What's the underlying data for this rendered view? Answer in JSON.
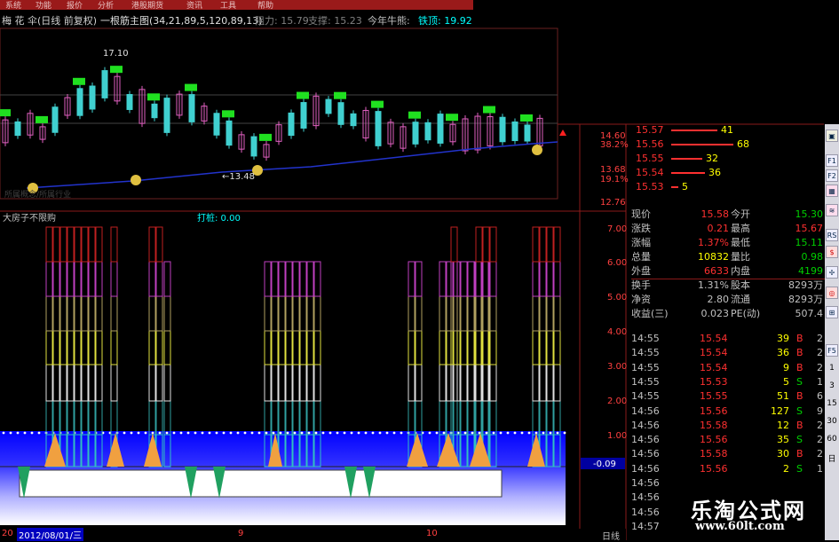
{
  "menu": [
    "系统",
    "功能",
    "报价",
    "分析",
    "港股期货",
    "资讯",
    "工具",
    "帮助"
  ],
  "title": {
    "stock_name": "梅 花 伞(日线 前复权)",
    "indicator": "一根筋主图(34,21,89,5,120,89,13)",
    "resistance_label": "阻力: 15.79",
    "support_label": "支撑: 15.23",
    "today_label": "今年牛熊:",
    "top_label": "铁顶: 19.92"
  },
  "main_chart": {
    "annotations": {
      "high": "17.10",
      "low": "←13.48"
    },
    "y_ticks": [
      "14.60",
      "38.2%",
      "13.68",
      "19.1%",
      "12.76"
    ],
    "watermark": "所属概念/所属行业"
  },
  "sub_chart": {
    "name": "大房子不限购",
    "daxian_label": "打桩: 0.00",
    "y_ticks": [
      "7.00",
      "6.00",
      "5.00",
      "4.00",
      "3.00",
      "2.00",
      "1.00"
    ],
    "current_value": "-0.09"
  },
  "bottom": {
    "date": "2012/08/01/三",
    "left_marker": "20",
    "month9": "9",
    "month10": "10",
    "period": "日线"
  },
  "order_book": [
    {
      "price": "15.57",
      "vol": "41",
      "bar": 52
    },
    {
      "price": "15.56",
      "vol": "68",
      "bar": 70
    },
    {
      "price": "15.55",
      "vol": "32",
      "bar": 35
    },
    {
      "price": "15.54",
      "vol": "36",
      "bar": 38
    },
    {
      "price": "15.53",
      "vol": "5",
      "bar": 8
    }
  ],
  "quote": [
    {
      "l1": "现价",
      "v1": "15.58",
      "c1": "#ff3030",
      "l2": "今开",
      "v2": "15.30",
      "c2": "#00d000"
    },
    {
      "l1": "涨跌",
      "v1": "0.21",
      "c1": "#ff3030",
      "l2": "最高",
      "v2": "15.67",
      "c2": "#ff3030"
    },
    {
      "l1": "涨幅",
      "v1": "1.37%",
      "c1": "#ff3030",
      "l2": "最低",
      "v2": "15.11",
      "c2": "#00d000"
    },
    {
      "l1": "总量",
      "v1": "10832",
      "c1": "#ffff00",
      "l2": "量比",
      "v2": "0.98",
      "c2": "#00d000"
    },
    {
      "l1": "外盘",
      "v1": "6633",
      "c1": "#ff3030",
      "l2": "内盘",
      "v2": "4199",
      "c2": "#00d000"
    },
    {
      "l1": "换手",
      "v1": "1.31%",
      "c1": "#c0c0c0",
      "l2": "股本",
      "v2": "8293万",
      "c2": "#c0c0c0"
    },
    {
      "l1": "净资",
      "v1": "2.80",
      "c1": "#c0c0c0",
      "l2": "流通",
      "v2": "8293万",
      "c2": "#c0c0c0"
    },
    {
      "l1": "收益(三)",
      "v1": "0.023",
      "c1": "#c0c0c0",
      "l2": "PE(动)",
      "v2": "507.4",
      "c2": "#c0c0c0"
    }
  ],
  "ticks": [
    {
      "t": "14:55",
      "p": "15.54",
      "v": "39",
      "bs": "B",
      "n": "2"
    },
    {
      "t": "14:55",
      "p": "15.54",
      "v": "36",
      "bs": "B",
      "n": "2"
    },
    {
      "t": "14:55",
      "p": "15.54",
      "v": "9",
      "bs": "B",
      "n": "2"
    },
    {
      "t": "14:55",
      "p": "15.53",
      "v": "5",
      "bs": "S",
      "n": "1"
    },
    {
      "t": "14:55",
      "p": "15.55",
      "v": "51",
      "bs": "B",
      "n": "6"
    },
    {
      "t": "14:56",
      "p": "15.56",
      "v": "127",
      "bs": "S",
      "n": "9"
    },
    {
      "t": "14:56",
      "p": "15.58",
      "v": "12",
      "bs": "B",
      "n": "2"
    },
    {
      "t": "14:56",
      "p": "15.56",
      "v": "35",
      "bs": "S",
      "n": "2"
    },
    {
      "t": "14:56",
      "p": "15.58",
      "v": "30",
      "bs": "B",
      "n": "2"
    },
    {
      "t": "14:56",
      "p": "15.56",
      "v": "2",
      "bs": "S",
      "n": "1"
    },
    {
      "t": "14:56",
      "p": "",
      "v": "",
      "bs": "",
      "n": ""
    },
    {
      "t": "14:56",
      "p": "",
      "v": "",
      "bs": "",
      "n": ""
    },
    {
      "t": "14:56",
      "p": "",
      "v": "",
      "bs": "",
      "n": ""
    },
    {
      "t": "14:57",
      "p": "",
      "v": "",
      "bs": "",
      "n": ""
    }
  ],
  "toolbar": {
    "icons": [
      "F1",
      "F2",
      "RS",
      "F5"
    ],
    "numbers": [
      "1",
      "3",
      "15",
      "30",
      "60",
      "日"
    ]
  },
  "watermark": {
    "cn": "乐淘公式网",
    "url": "www.60lt.com"
  }
}
